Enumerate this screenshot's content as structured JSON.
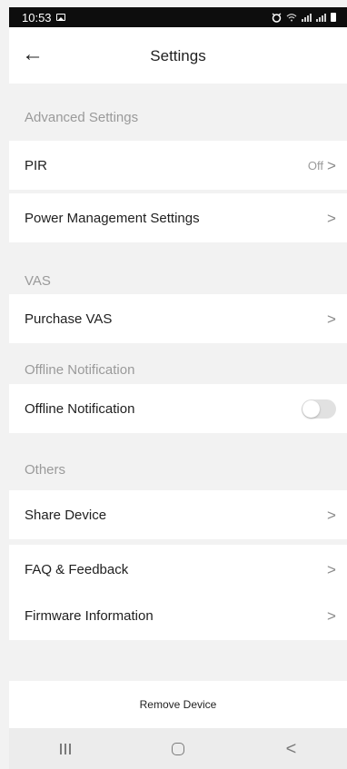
{
  "status_bar": {
    "time": "10:53",
    "icons": [
      "image-notification-icon",
      "alarm-icon",
      "wifi-icon",
      "signal-icon",
      "battery-icon"
    ]
  },
  "header": {
    "title": "Settings",
    "back_icon": "arrow-left-icon"
  },
  "sections": {
    "advanced": {
      "title": "Advanced Settings",
      "pir": {
        "label": "PIR",
        "value": "Off"
      },
      "power": {
        "label": "Power Management Settings"
      }
    },
    "vas": {
      "title": "VAS",
      "purchase": {
        "label": "Purchase VAS"
      }
    },
    "offline": {
      "title": "Offline Notification",
      "toggle_item": {
        "label": "Offline Notification",
        "enabled": false
      }
    },
    "others": {
      "title": "Others",
      "share": {
        "label": "Share Device"
      },
      "faq": {
        "label": "FAQ & Feedback"
      },
      "firmware": {
        "label": "Firmware Information"
      }
    }
  },
  "remove_device": {
    "label": "Remove Device"
  },
  "glyphs": {
    "chevron": ">",
    "back_arrow": "←",
    "nav_back": "<"
  },
  "colors": {
    "background": "#f2f2f2",
    "row_background": "#ffffff",
    "section_text": "#9a9a9a",
    "toggle_off": "#e1e1e1"
  }
}
